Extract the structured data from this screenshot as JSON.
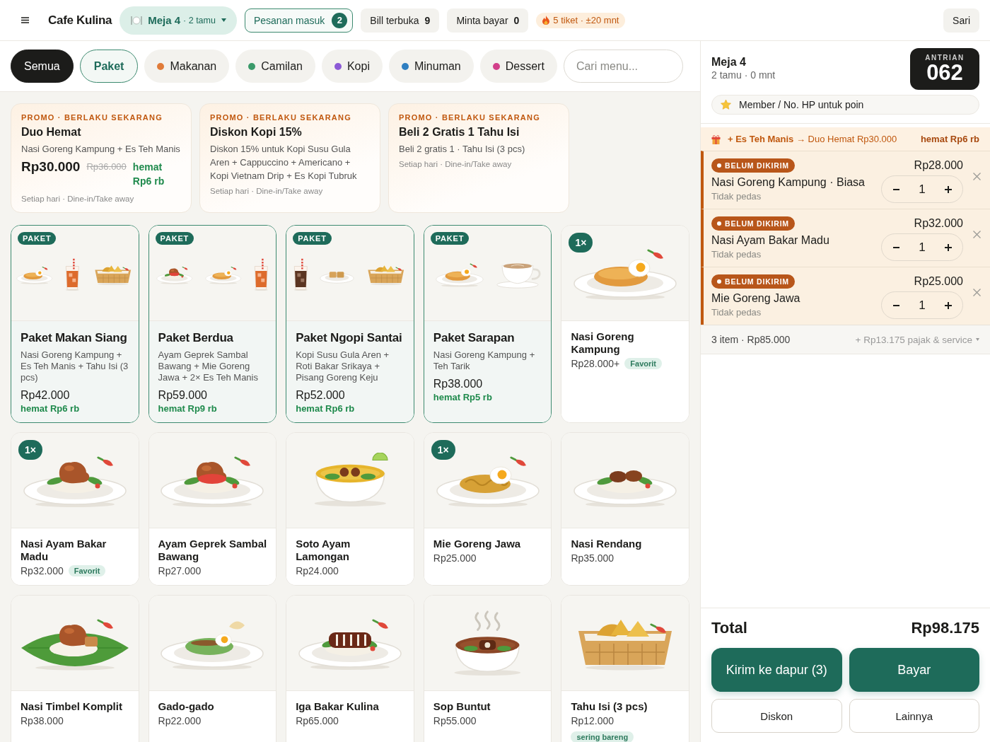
{
  "topbar": {
    "brand": "Cafe Kulina",
    "table": {
      "label": "Meja 4",
      "guests": "· 2 tamu"
    },
    "incoming": {
      "label": "Pesanan masuk",
      "count": "2"
    },
    "stats": [
      {
        "label": "Bill terbuka",
        "value": "9"
      },
      {
        "label": "Minta bayar",
        "value": "0"
      }
    ],
    "kitchen": "5 tiket · ±20 mnt",
    "user": "Sari"
  },
  "filters": {
    "chips": [
      {
        "label": "Semua",
        "kind": "plain",
        "selected": true
      },
      {
        "label": "Paket",
        "kind": "package",
        "selected": false
      },
      {
        "label": "Makanan",
        "kind": "category",
        "color": "#e07b39",
        "selected": false
      },
      {
        "label": "Camilan",
        "kind": "category",
        "color": "#3a9a6a",
        "selected": false
      },
      {
        "label": "Kopi",
        "kind": "category",
        "color": "#8c5ad6",
        "selected": false
      },
      {
        "label": "Minuman",
        "kind": "category",
        "color": "#2f7fc1",
        "selected": false
      },
      {
        "label": "Dessert",
        "kind": "category",
        "color": "#d23f8a",
        "selected": false
      }
    ],
    "search": {
      "placeholder": "Cari menu..."
    }
  },
  "promos": [
    {
      "tag": "PROMO · BERLAKU SEKARANG",
      "title": "Duo Hemat",
      "description": "Nasi Goreng Kampung + Es Teh Manis",
      "price": "Rp30.000",
      "old_price": "Rp36.000",
      "saving": "hemat Rp6 rb",
      "schedule": "Setiap hari · Dine-in/Take away"
    },
    {
      "tag": "PROMO · BERLAKU SEKARANG",
      "title": "Diskon Kopi 15%",
      "description": "Diskon 15% untuk Kopi Susu Gula Aren + Cappuccino + Americano + Kopi Vietnam Drip + Es Kopi Tubruk",
      "schedule": "Setiap hari · Dine-in/Take away"
    },
    {
      "tag": "PROMO · BERLAKU SEKARANG",
      "title": "Beli 2 Gratis 1 Tahu Isi",
      "description": "Beli 2 gratis 1 · Tahu Isi (3 pcs)",
      "schedule": "Setiap hari · Dine-in/Take away"
    }
  ],
  "menu": [
    {
      "kind": "paket",
      "badge": "PAKET",
      "name": "Paket Makan Siang",
      "description": "Nasi Goreng Kampung + Es Teh Manis + Tahu Isi (3 pcs)",
      "price": "Rp42.000",
      "saving": "hemat Rp6 rb"
    },
    {
      "kind": "paket",
      "badge": "PAKET",
      "name": "Paket Berdua",
      "description": "Ayam Geprek Sambal Bawang + Mie Goreng Jawa + 2× Es Teh Manis",
      "price": "Rp59.000",
      "saving": "hemat Rp9 rb"
    },
    {
      "kind": "paket",
      "badge": "PAKET",
      "name": "Paket Ngopi Santai",
      "description": "Kopi Susu Gula Aren + Roti Bakar Srikaya + Pisang Goreng Keju",
      "price": "Rp52.000",
      "saving": "hemat Rp6 rb"
    },
    {
      "kind": "paket",
      "badge": "PAKET",
      "name": "Paket Sarapan",
      "description": "Nasi Goreng Kampung + Teh Tarik",
      "price": "Rp38.000",
      "saving": "hemat Rp5 rb"
    },
    {
      "kind": "dish",
      "quantity": "1×",
      "name": "Nasi Goreng Kampung",
      "price": "Rp28.000+",
      "tag": "Favorit"
    },
    {
      "kind": "dish",
      "quantity": "1×",
      "name": "Nasi Ayam Bakar Madu",
      "price": "Rp32.000",
      "tag": "Favorit"
    },
    {
      "kind": "dish",
      "name": "Ayam Geprek Sambal Bawang",
      "price": "Rp27.000"
    },
    {
      "kind": "dish",
      "name": "Soto Ayam Lamongan",
      "price": "Rp24.000"
    },
    {
      "kind": "dish",
      "quantity": "1×",
      "name": "Mie Goreng Jawa",
      "price": "Rp25.000"
    },
    {
      "kind": "dish",
      "name": "Nasi Rendang",
      "price": "Rp35.000"
    },
    {
      "kind": "dish",
      "name": "Nasi Timbel Komplit",
      "price": "Rp38.000"
    },
    {
      "kind": "dish",
      "name": "Gado-gado",
      "price": "Rp22.000"
    },
    {
      "kind": "dish",
      "name": "Iga Bakar Kulina",
      "price": "Rp65.000"
    },
    {
      "kind": "dish",
      "name": "Sop Buntut",
      "price": "Rp55.000"
    },
    {
      "kind": "dish",
      "name": "Tahu Isi (3 pcs)",
      "price": "Rp12.000",
      "tag": "sering bareng"
    }
  ],
  "order": {
    "table": "Meja 4",
    "info": "2 tamu · 0 mnt",
    "queue": {
      "label": "ANTRIAN",
      "number": "062"
    },
    "member": {
      "placeholder": "Member / No. HP untuk poin"
    },
    "suggestion": {
      "text": "**+ Es Teh Manis** → Duo Hemat Rp30.000",
      "saving": "hemat Rp6 rb"
    },
    "items": [
      {
        "status": "BELUM DIKIRIM",
        "sent": false,
        "name": "Nasi Goreng Kampung · Biasa",
        "note": "Tidak pedas",
        "price": "Rp28.000",
        "quantity": "1"
      },
      {
        "status": "BELUM DIKIRIM",
        "sent": false,
        "name": "Nasi Ayam Bakar Madu",
        "note": "Tidak pedas",
        "price": "Rp32.000",
        "quantity": "1"
      },
      {
        "status": "BELUM DIKIRIM",
        "sent": false,
        "name": "Mie Goreng Jawa",
        "note": "Tidak pedas",
        "price": "Rp25.000",
        "quantity": "1"
      }
    ],
    "summary": {
      "items": "3 item · Rp85.000",
      "charges": "+ Rp13.175 pajak & service"
    },
    "total": {
      "label": "Total",
      "value": "Rp98.175"
    },
    "actions": [
      {
        "label": "Kirim ke dapur (3)",
        "kind": "primary"
      },
      {
        "label": "Bayar",
        "kind": "primary"
      },
      {
        "label": "Diskon",
        "kind": "secondary"
      },
      {
        "label": "Lainnya",
        "kind": "secondary"
      }
    ]
  }
}
